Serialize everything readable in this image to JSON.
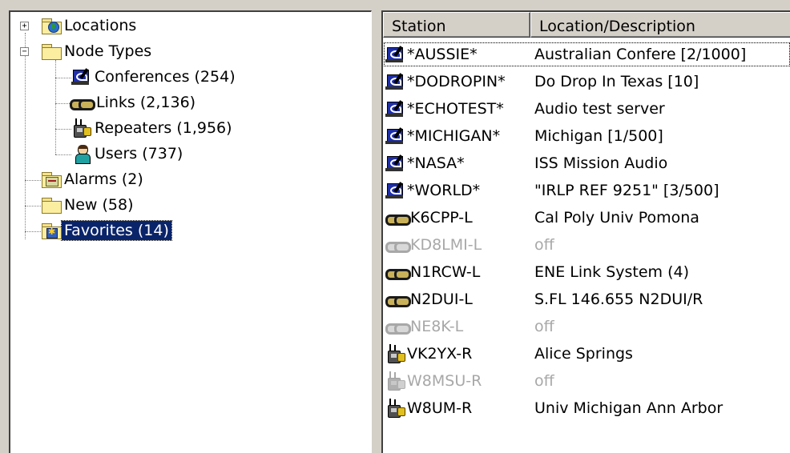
{
  "tree": {
    "items": [
      {
        "label": "Locations",
        "icon": "globe-folder-icon",
        "expander": "+"
      },
      {
        "label": "Node Types",
        "icon": "folder-icon",
        "expander": "−"
      },
      {
        "label": "Conferences (254)",
        "icon": "conference-icon"
      },
      {
        "label": "Links (2,136)",
        "icon": "link-icon"
      },
      {
        "label": "Repeaters (1,956)",
        "icon": "repeater-icon"
      },
      {
        "label": "Users (737)",
        "icon": "user-icon"
      },
      {
        "label": "Alarms (2)",
        "icon": "alarm-folder-icon"
      },
      {
        "label": "New (58)",
        "icon": "folder-icon"
      },
      {
        "label": "Favorites (14)",
        "icon": "favorites-folder-icon",
        "selected": true
      }
    ]
  },
  "list": {
    "columns": [
      "Station",
      "Location/Description"
    ],
    "rows": [
      {
        "station": "*AUSSIE*",
        "location": "Australian Confere [2/1000]",
        "type": "conference-icon",
        "status": "on"
      },
      {
        "station": "*DODROPIN*",
        "location": "Do Drop In Texas [10]",
        "type": "conference-icon",
        "status": "on"
      },
      {
        "station": "*ECHOTEST*",
        "location": "Audio test server",
        "type": "conference-icon",
        "status": "on"
      },
      {
        "station": "*MICHIGAN*",
        "location": "Michigan [1/500]",
        "type": "conference-icon",
        "status": "on"
      },
      {
        "station": "*NASA*",
        "location": "ISS Mission Audio",
        "type": "conference-icon",
        "status": "on"
      },
      {
        "station": "*WORLD*",
        "location": "\"IRLP REF 9251\" [3/500]",
        "type": "conference-icon",
        "status": "on"
      },
      {
        "station": "K6CPP-L",
        "location": "Cal Poly Univ Pomona",
        "type": "link-icon",
        "status": "on"
      },
      {
        "station": "KD8LMI-L",
        "location": "off",
        "type": "link-icon",
        "status": "off"
      },
      {
        "station": "N1RCW-L",
        "location": "ENE Link System (4)",
        "type": "link-icon",
        "status": "on"
      },
      {
        "station": "N2DUI-L",
        "location": "S.FL 146.655 N2DUI/R",
        "type": "link-icon",
        "status": "on"
      },
      {
        "station": "NE8K-L",
        "location": "off",
        "type": "link-icon",
        "status": "off"
      },
      {
        "station": "VK2YX-R",
        "location": "Alice Springs",
        "type": "repeater-icon",
        "status": "on"
      },
      {
        "station": "W8MSU-R",
        "location": "off",
        "type": "repeater-icon",
        "status": "off"
      },
      {
        "station": "W8UM-R",
        "location": "Univ Michigan Ann Arbor",
        "type": "repeater-icon",
        "status": "on"
      }
    ]
  },
  "colors": {
    "selection": "#0a246a",
    "off_text": "#a8a8a8",
    "window_bg": "#d4d0c8"
  }
}
